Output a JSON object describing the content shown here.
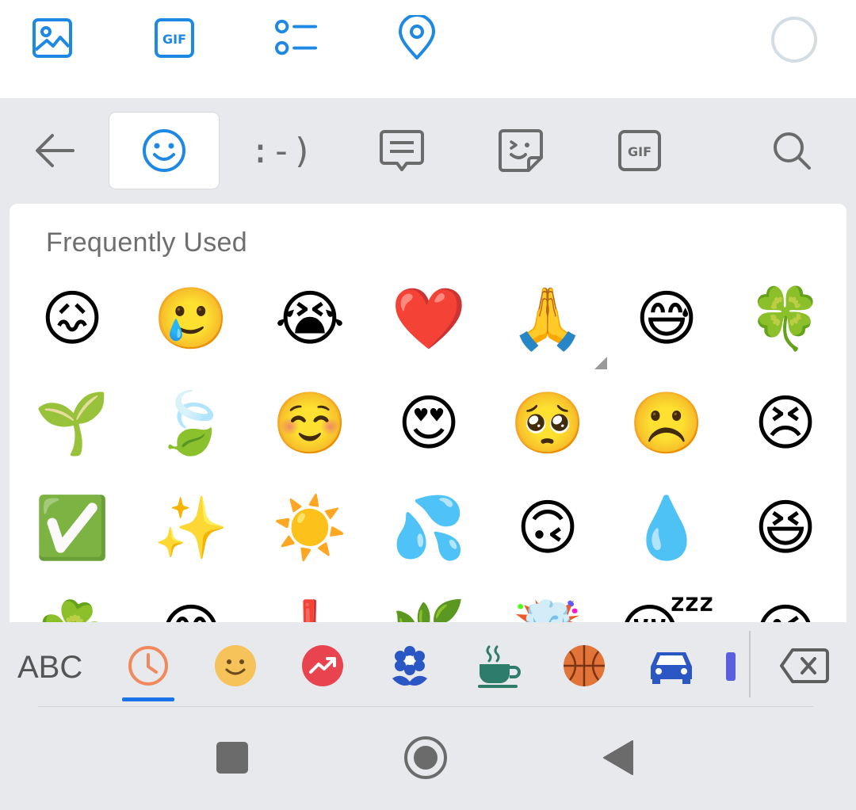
{
  "toolbar": {
    "icons": [
      "image-icon",
      "gif-icon",
      "list-icon",
      "location-icon"
    ],
    "gif_label": "GIF",
    "accent": "#1e88e5"
  },
  "categories": {
    "tabs": [
      "back-arrow-icon",
      "emoji-face-icon",
      "emoticon-icon",
      "text-message-icon",
      "sticker-icon",
      "gif-icon",
      "search-icon"
    ],
    "emoticon_text": ":-)",
    "gif_label": "GIF",
    "active_tab": "emoji-face-icon"
  },
  "panel": {
    "title": "Frequently Used",
    "emojis": [
      [
        "😖",
        "🥲",
        "😭",
        "❤️",
        "🙏",
        "😅",
        "🍀"
      ],
      [
        "🌱",
        "🍃",
        "☺️",
        "😍",
        "🥺",
        "☹️",
        "😣"
      ],
      [
        "✅",
        "✨",
        "☀️",
        "💦",
        "🙃",
        "💧",
        "😆"
      ],
      [
        "☘️",
        "😊",
        "❗",
        "🌿",
        "🤯",
        "😴",
        "😉"
      ]
    ]
  },
  "bottom_nav": {
    "abc_label": "ABC",
    "icons": [
      "recent-clock-icon",
      "smiley-icon",
      "trending-icon",
      "flower-icon",
      "coffee-icon",
      "basketball-icon",
      "car-icon",
      "object-icon",
      "backspace-icon"
    ],
    "active": "recent-clock-icon"
  },
  "system_nav": {
    "icons": [
      "recents-square-icon",
      "home-circle-icon",
      "back-triangle-icon"
    ]
  }
}
